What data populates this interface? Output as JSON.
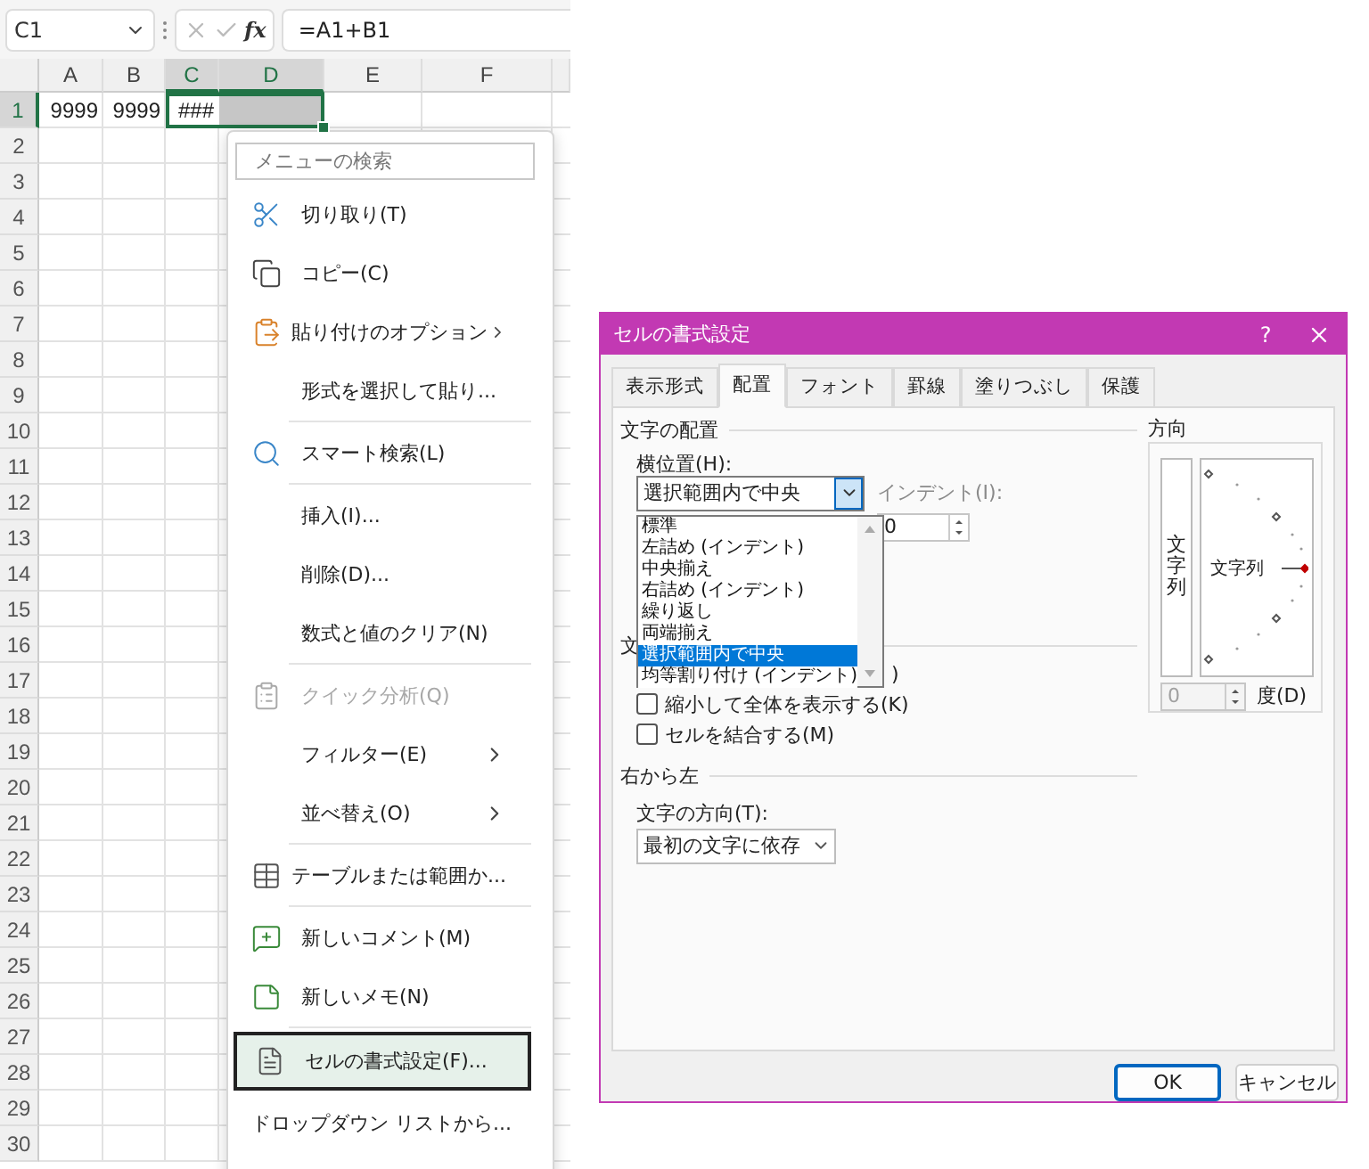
{
  "name_box": {
    "value": "C1"
  },
  "formula_bar": {
    "function_label": "fx",
    "formula": "=A1+B1"
  },
  "sheet": {
    "columns": [
      {
        "label": "A",
        "selected": false
      },
      {
        "label": "B",
        "selected": false
      },
      {
        "label": "C",
        "selected": true
      },
      {
        "label": "D",
        "selected": true
      },
      {
        "label": "E",
        "selected": false
      },
      {
        "label": "F",
        "selected": false
      }
    ],
    "rows": [
      {
        "label": "1",
        "selected": true,
        "cells": [
          {
            "text": "9999",
            "selected": false
          },
          {
            "text": "9999",
            "selected": false
          },
          {
            "text": "###",
            "selected": true,
            "active": true
          },
          {
            "selected": true,
            "active": false
          }
        ]
      },
      {
        "label": "2",
        "selected": false
      },
      {
        "label": "3",
        "selected": false
      },
      {
        "label": "4",
        "selected": false
      },
      {
        "label": "5",
        "selected": false
      },
      {
        "label": "6",
        "selected": false
      },
      {
        "label": "7",
        "selected": false
      },
      {
        "label": "8",
        "selected": false
      },
      {
        "label": "9",
        "selected": false
      },
      {
        "label": "10",
        "selected": false
      },
      {
        "label": "11",
        "selected": false
      },
      {
        "label": "12",
        "selected": false
      },
      {
        "label": "13",
        "selected": false
      },
      {
        "label": "14",
        "selected": false
      },
      {
        "label": "15",
        "selected": false
      },
      {
        "label": "16",
        "selected": false
      },
      {
        "label": "17",
        "selected": false
      },
      {
        "label": "18",
        "selected": false
      },
      {
        "label": "19",
        "selected": false
      },
      {
        "label": "20",
        "selected": false
      },
      {
        "label": "21",
        "selected": false
      },
      {
        "label": "22",
        "selected": false
      },
      {
        "label": "23",
        "selected": false
      },
      {
        "label": "24",
        "selected": false
      },
      {
        "label": "25",
        "selected": false
      },
      {
        "label": "26",
        "selected": false
      },
      {
        "label": "27",
        "selected": false
      },
      {
        "label": "28",
        "selected": false
      },
      {
        "label": "29",
        "selected": false
      },
      {
        "label": "30",
        "selected": false
      }
    ]
  },
  "context_menu": {
    "search": {
      "placeholder": "メニューの検索"
    },
    "items": [
      {
        "label": "切り取り(T)",
        "separator_before": false,
        "submenu": false,
        "disabled": false,
        "highlighted": false
      },
      {
        "label": "コピー(C)",
        "separator_before": false,
        "submenu": false,
        "disabled": false,
        "highlighted": false
      },
      {
        "label": "貼り付けのオプション",
        "separator_before": false,
        "submenu": true,
        "disabled": false,
        "highlighted": false
      },
      {
        "label": "形式を選択して貼り...",
        "separator_before": false,
        "submenu": false,
        "disabled": false,
        "highlighted": false
      },
      {
        "label": "スマート検索(L)",
        "separator_before": true,
        "submenu": false,
        "disabled": false,
        "highlighted": false
      },
      {
        "label": "挿入(I)...",
        "separator_before": true,
        "submenu": false,
        "disabled": false,
        "highlighted": false
      },
      {
        "label": "削除(D)...",
        "separator_before": false,
        "submenu": false,
        "disabled": false,
        "highlighted": false
      },
      {
        "label": "数式と値のクリア(N)",
        "separator_before": false,
        "submenu": false,
        "disabled": false,
        "highlighted": false
      },
      {
        "label": "クイック分析(Q)",
        "separator_before": true,
        "submenu": false,
        "disabled": true,
        "highlighted": false
      },
      {
        "label": "フィルター(E)",
        "separator_before": false,
        "submenu": true,
        "disabled": false,
        "highlighted": false
      },
      {
        "label": "並べ替え(O)",
        "separator_before": false,
        "submenu": true,
        "disabled": false,
        "highlighted": false
      },
      {
        "label": "テーブルまたは範囲か...",
        "separator_before": true,
        "submenu": false,
        "disabled": false,
        "highlighted": false
      },
      {
        "label": "新しいコメント(M)",
        "separator_before": true,
        "submenu": false,
        "disabled": false,
        "highlighted": false
      },
      {
        "label": "新しいメモ(N)",
        "separator_before": false,
        "submenu": false,
        "disabled": false,
        "highlighted": false
      },
      {
        "label": "セルの書式設定(F)...",
        "separator_before": true,
        "submenu": false,
        "disabled": false,
        "highlighted": true
      },
      {
        "label": "ドロップダウン リストから...",
        "separator_before": false,
        "submenu": false,
        "disabled": false,
        "highlighted": false
      }
    ]
  },
  "dialog": {
    "title": "セルの書式設定",
    "help": "?",
    "tabs": [
      {
        "label": "表示形式",
        "selected": false
      },
      {
        "label": "配置",
        "selected": true
      },
      {
        "label": "フォント",
        "selected": false
      },
      {
        "label": "罫線",
        "selected": false
      },
      {
        "label": "塗りつぶし",
        "selected": false
      },
      {
        "label": "保護",
        "selected": false
      }
    ],
    "alignment": {
      "title": "文字の配置",
      "horizontal": {
        "label": "横位置(H):",
        "value": "選択範囲内で中央",
        "options": [
          {
            "label": "標準",
            "selected": false
          },
          {
            "label": "左詰め (インデント)",
            "selected": false
          },
          {
            "label": "中央揃え",
            "selected": false
          },
          {
            "label": "右詰め (インデント)",
            "selected": false
          },
          {
            "label": "繰り返し",
            "selected": false
          },
          {
            "label": "両端揃え",
            "selected": false
          },
          {
            "label": "選択範囲内で中央",
            "selected": true
          },
          {
            "label": "均等割り付け (インデント)",
            "selected": false
          }
        ]
      },
      "indent": {
        "label": "インデント(I):",
        "disabled": true,
        "value": "0"
      }
    },
    "text_control": {
      "title": "文",
      "covered_label_tail": ")",
      "checkboxes": [
        {
          "label": "縮小して全体を表示する(K)",
          "checked": false
        },
        {
          "label": "セルを結合する(M)",
          "checked": false
        }
      ]
    },
    "right_to_left": {
      "title": "右から左",
      "direction": {
        "label": "文字の方向(T):",
        "value": "最初の文字に依存"
      }
    },
    "orientation": {
      "title": "方向",
      "vertical_text": "文字列",
      "dial_text": "文字列",
      "degrees": {
        "value": "0",
        "label": "度(D)",
        "disabled": true
      }
    },
    "buttons": [
      {
        "label": "OK",
        "default": true
      },
      {
        "label": "キャンセル",
        "default": false
      }
    ]
  }
}
